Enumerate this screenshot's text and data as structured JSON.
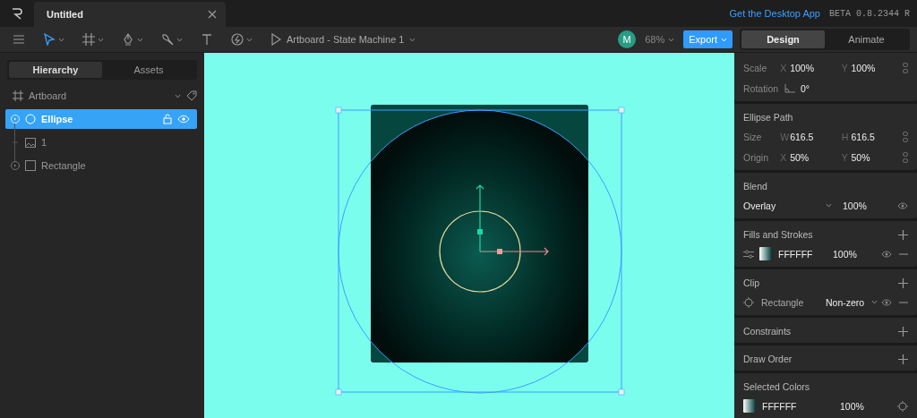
{
  "title_bar": {
    "tabs": [
      {
        "label": "Untitled",
        "selected": true
      }
    ],
    "link": "Get the Desktop App",
    "version": "BETA 0.8.2344 R"
  },
  "toolbar": {
    "state_machine": "Artboard - State Machine 1",
    "avatar": "M",
    "zoom": "68%",
    "export": "Export",
    "modes": [
      {
        "label": "Design",
        "selected": true
      },
      {
        "label": "Animate",
        "selected": false
      }
    ]
  },
  "left_panel": {
    "tabs": [
      {
        "label": "Hierarchy",
        "selected": true
      },
      {
        "label": "Assets",
        "selected": false
      }
    ],
    "artboard": "Artboard",
    "layers": [
      {
        "name": "Ellipse",
        "kind": "ellipse",
        "expandable": true,
        "selected": true
      },
      {
        "name": "1",
        "kind": "image",
        "expandable": false,
        "selected": false
      },
      {
        "name": "Rectangle",
        "kind": "rectangle",
        "expandable": true,
        "selected": false
      }
    ]
  },
  "inspector": {
    "sections": [
      {
        "rows": [
          {
            "kind": "pair",
            "label": "Scale",
            "fields": [
              {
                "axis": "X",
                "value": "100%"
              },
              {
                "axis": "Y",
                "value": "100%"
              }
            ]
          },
          {
            "kind": "single",
            "label": "Rotation",
            "value": "0°"
          }
        ]
      },
      {
        "title": "Ellipse Path",
        "rows": [
          {
            "kind": "pair",
            "label": "Size",
            "fields": [
              {
                "axis": "W",
                "value": "616.5"
              },
              {
                "axis": "H",
                "value": "616.5"
              }
            ]
          },
          {
            "kind": "pair",
            "label": "Origin",
            "fields": [
              {
                "axis": "X",
                "value": "50%"
              },
              {
                "axis": "Y",
                "value": "50%"
              }
            ]
          }
        ]
      },
      {
        "title": "Blend",
        "rows": [
          {
            "kind": "blend",
            "value": "Overlay",
            "opacity": "100%"
          }
        ]
      },
      {
        "title": "Fills and Strokes",
        "add": true,
        "rows": [
          {
            "kind": "fill",
            "value": "FFFFFF",
            "opacity": "100%"
          }
        ]
      },
      {
        "title": "Clip",
        "add": true,
        "rows": [
          {
            "kind": "clip",
            "value": "Rectangle",
            "rule": "Non-zero"
          }
        ]
      },
      {
        "title": "Constraints",
        "add": true
      },
      {
        "title": "Draw Order",
        "add": true
      },
      {
        "title": "Selected Colors",
        "rows": [
          {
            "kind": "color",
            "value": "FFFFFF",
            "opacity": "100%"
          }
        ]
      }
    ]
  }
}
